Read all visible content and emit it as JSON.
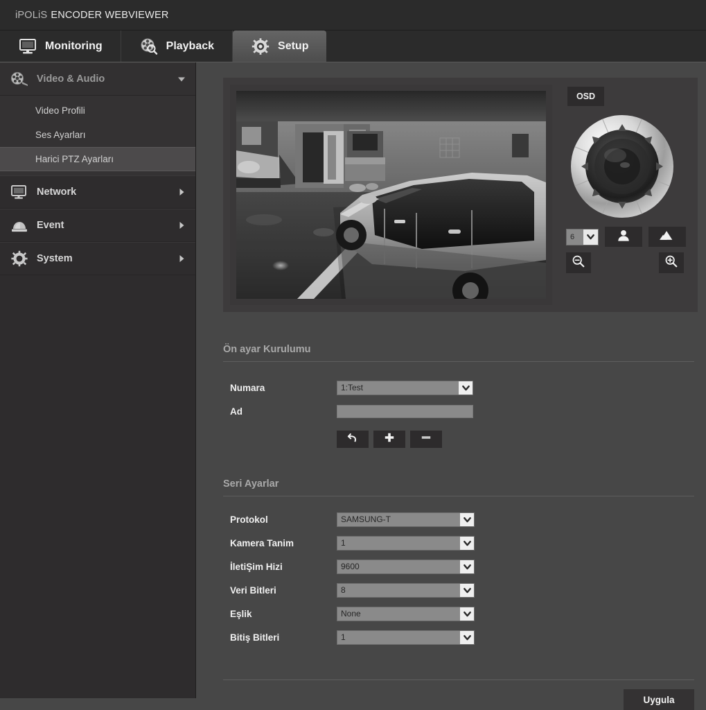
{
  "header": {
    "brand_prefix": "iPOLiS",
    "brand_suffix": "ENCODER WEBVIEWER"
  },
  "tabs": [
    {
      "label": "Monitoring",
      "icon": "monitor-icon",
      "active": false
    },
    {
      "label": "Playback",
      "icon": "film-reel-search-icon",
      "active": false
    },
    {
      "label": "Setup",
      "icon": "gear-icon",
      "active": true
    }
  ],
  "sidebar": {
    "groups": [
      {
        "label": "Video & Audio",
        "icon": "film-reel-icon",
        "expanded": true,
        "arrow": "chevron-down-icon",
        "items": [
          {
            "label": "Video Profili",
            "selected": false
          },
          {
            "label": "Ses Ayarları",
            "selected": false
          },
          {
            "label": "Harici PTZ Ayarları",
            "selected": true
          }
        ]
      },
      {
        "label": "Network",
        "icon": "monitor-icon",
        "expanded": false,
        "arrow": "chevron-right-icon",
        "items": []
      },
      {
        "label": "Event",
        "icon": "alarm-dome-icon",
        "expanded": false,
        "arrow": "chevron-right-icon",
        "items": []
      },
      {
        "label": "System",
        "icon": "gear-icon",
        "expanded": false,
        "arrow": "chevron-right-icon",
        "items": []
      }
    ]
  },
  "viewer": {
    "scene_description": "grayscale parking garage surveillance view with parked car",
    "osd_label": "OSD",
    "dpad": {
      "up": "arrow-up-icon",
      "down": "arrow-down-icon",
      "left": "arrow-left-icon",
      "right": "arrow-right-icon",
      "up_left": "arrow-up-left-icon",
      "up_right": "arrow-up-right-icon",
      "down_left": "arrow-down-left-icon",
      "down_right": "arrow-down-right-icon"
    },
    "speed": {
      "value": "6",
      "arrow": "chevron-down-icon"
    },
    "focus_near": "person-icon",
    "focus_far": "mountain-icon",
    "zoom_out": "magnifier-minus-icon",
    "zoom_in": "magnifier-plus-icon"
  },
  "preset_section": {
    "title": "Ön ayar Kurulumu",
    "rows": [
      {
        "label": "Numara",
        "type": "select",
        "value": "1:Test"
      },
      {
        "label": "Ad",
        "type": "text",
        "value": ""
      }
    ],
    "buttons": [
      {
        "name": "preset-goto-button",
        "icon": "undo-arrow-icon"
      },
      {
        "name": "preset-add-button",
        "icon": "plus-icon"
      },
      {
        "name": "preset-remove-button",
        "icon": "minus-icon"
      }
    ]
  },
  "serial_section": {
    "title": "Seri Ayarlar",
    "rows": [
      {
        "label": "Protokol",
        "value": "SAMSUNG-T"
      },
      {
        "label": "Kamera Tanim",
        "value": "1"
      },
      {
        "label": "İletiŞim Hizi",
        "value": "9600"
      },
      {
        "label": "Veri Bitleri",
        "value": "8"
      },
      {
        "label": "Eşlik",
        "value": "None"
      },
      {
        "label": "Bitiş Bitleri",
        "value": "1"
      }
    ]
  },
  "footer": {
    "apply_label": "Uygula"
  },
  "colors": {
    "page_bg": "#474747",
    "sidebar_bg": "#2e2c2d",
    "header_bg": "#2b2b2b",
    "panel_bg": "#3d3b3c",
    "field_bg": "#8a8a8a",
    "button_bg": "#2d2b2c",
    "text_primary": "#f0f0f0",
    "text_muted": "#a9a9a9"
  }
}
